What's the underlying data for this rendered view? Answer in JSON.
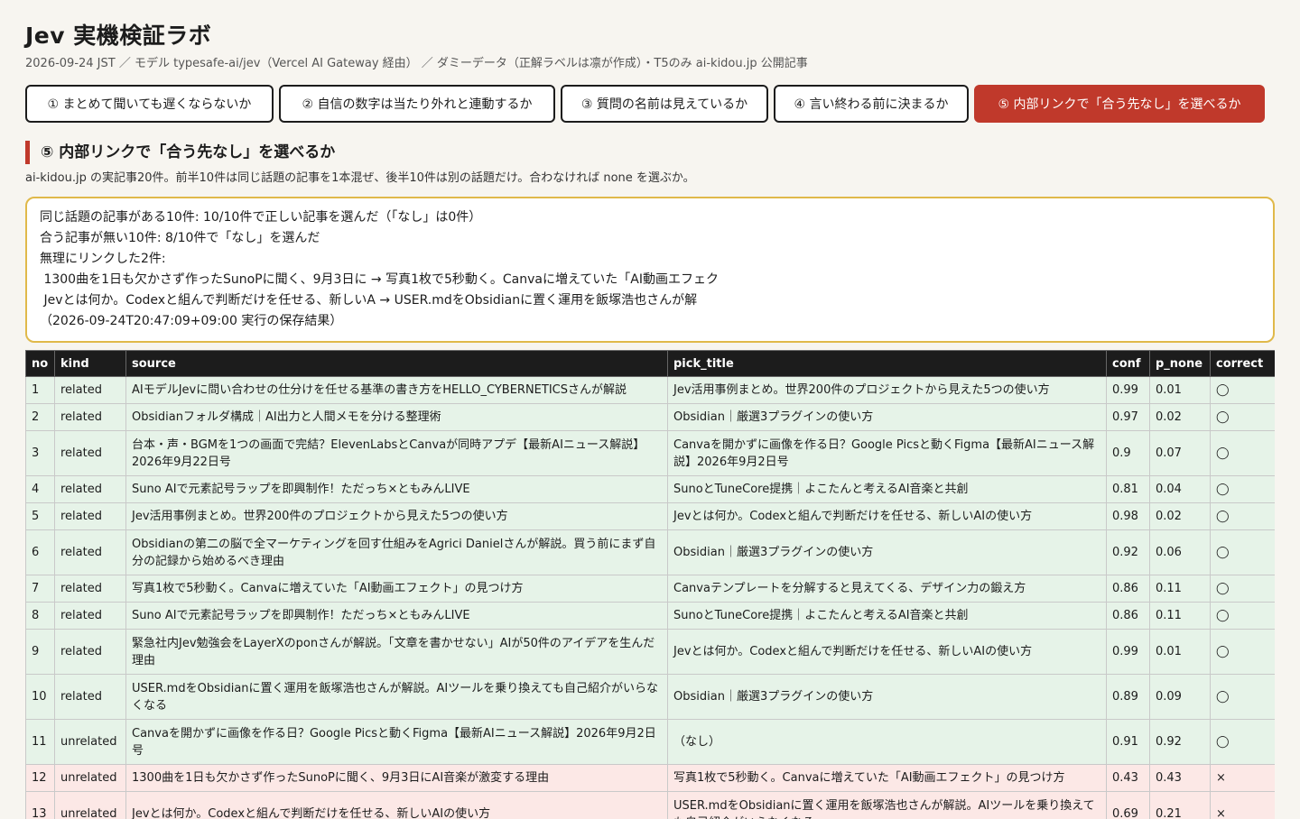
{
  "header": {
    "title": "Jev 実機検証ラボ",
    "subtitle": "2026-09-24 JST ／ モデル typesafe-ai/jev（Vercel AI Gateway 経由） ／ ダミーデータ（正解ラベルは凛が作成）・T5のみ ai-kidou.jp 公開記事"
  },
  "tabs": [
    {
      "label": "① まとめて聞いても遅くならないか"
    },
    {
      "label": "② 自信の数字は当たり外れと連動するか"
    },
    {
      "label": "③ 質問の名前は見えているか"
    },
    {
      "label": "④ 言い終わる前に決まるか"
    },
    {
      "label": "⑤ 内部リンクで「合う先なし」を選べるか"
    }
  ],
  "section": {
    "title": "⑤ 内部リンクで「合う先なし」を選べるか",
    "description": "ai-kidou.jp の実記事20件。前半10件は同じ話題の記事を1本混ぜ、後半10件は別の話題だけ。合わなければ none を選ぶか。"
  },
  "summary": {
    "lines": [
      "同じ話題の記事がある10件: 10/10件で正しい記事を選んだ（「なし」は0件）",
      "合う記事が無い10件: 8/10件で「なし」を選んだ",
      "無理にリンクした2件:",
      " 1300曲を1日も欠かさず作ったSunoPに聞く、9月3日に → 写真1枚で5秒動く。Canvaに増えていた「AI動画エフェク",
      " Jevとは何か。Codexと組んで判断だけを任せる、新しいA → USER.mdをObsidianに置く運用を飯塚浩也さんが解",
      "（2026-09-24T20:47:09+09:00 実行の保存結果）"
    ]
  },
  "table": {
    "headers": [
      "no",
      "kind",
      "source",
      "pick_title",
      "conf",
      "p_none",
      "correct"
    ],
    "rows": [
      {
        "no": "1",
        "kind": "related",
        "source": "AIモデルJevに問い合わせの仕分けを任せる基準の書き方をHELLO_CYBERNETICSさんが解説",
        "pick": "Jev活用事例まとめ。世界200件のプロジェクトから見えた5つの使い方",
        "conf": "0.99",
        "p_none": "0.01",
        "correct": "◯",
        "ok": true
      },
      {
        "no": "2",
        "kind": "related",
        "source": "Obsidianフォルダ構成｜AI出力と人間メモを分ける整理術",
        "pick": "Obsidian｜厳選3プラグインの使い方",
        "conf": "0.97",
        "p_none": "0.02",
        "correct": "◯",
        "ok": true
      },
      {
        "no": "3",
        "kind": "related",
        "source": "台本・声・BGMを1つの画面で完結？ElevenLabsとCanvaが同時アプデ【最新AIニュース解説】2026年9月22日号",
        "pick": "Canvaを開かずに画像を作る日？Google Picsと動くFigma【最新AIニュース解説】2026年9月2日号",
        "conf": "0.9",
        "p_none": "0.07",
        "correct": "◯",
        "ok": true
      },
      {
        "no": "4",
        "kind": "related",
        "source": "Suno AIで元素記号ラップを即興制作！ただっち×ともみんLIVE",
        "pick": "SunoとTuneCore提携｜よこたんと考えるAI音楽と共創",
        "conf": "0.81",
        "p_none": "0.04",
        "correct": "◯",
        "ok": true
      },
      {
        "no": "5",
        "kind": "related",
        "source": "Jev活用事例まとめ。世界200件のプロジェクトから見えた5つの使い方",
        "pick": "Jevとは何か。Codexと組んで判断だけを任せる、新しいAIの使い方",
        "conf": "0.98",
        "p_none": "0.02",
        "correct": "◯",
        "ok": true
      },
      {
        "no": "6",
        "kind": "related",
        "source": "Obsidianの第二の脳で全マーケティングを回す仕組みをAgrici Danielさんが解説。買う前にまず自分の記録から始めるべき理由",
        "pick": "Obsidian｜厳選3プラグインの使い方",
        "conf": "0.92",
        "p_none": "0.06",
        "correct": "◯",
        "ok": true
      },
      {
        "no": "7",
        "kind": "related",
        "source": "写真1枚で5秒動く。Canvaに増えていた「AI動画エフェクト」の見つけ方",
        "pick": "Canvaテンプレートを分解すると見えてくる、デザイン力の鍛え方",
        "conf": "0.86",
        "p_none": "0.11",
        "correct": "◯",
        "ok": true
      },
      {
        "no": "8",
        "kind": "related",
        "source": "Suno AIで元素記号ラップを即興制作！ただっち×ともみんLIVE",
        "pick": "SunoとTuneCore提携｜よこたんと考えるAI音楽と共創",
        "conf": "0.86",
        "p_none": "0.11",
        "correct": "◯",
        "ok": true
      },
      {
        "no": "9",
        "kind": "related",
        "source": "緊急社内Jev勉強会をLayerXのponさんが解説。「文章を書かせない」AIが50件のアイデアを生んだ理由",
        "pick": "Jevとは何か。Codexと組んで判断だけを任せる、新しいAIの使い方",
        "conf": "0.99",
        "p_none": "0.01",
        "correct": "◯",
        "ok": true
      },
      {
        "no": "10",
        "kind": "related",
        "source": "USER.mdをObsidianに置く運用を飯塚浩也さんが解説。AIツールを乗り換えても自己紹介がいらなくなる",
        "pick": "Obsidian｜厳選3プラグインの使い方",
        "conf": "0.89",
        "p_none": "0.09",
        "correct": "◯",
        "ok": true
      },
      {
        "no": "11",
        "kind": "unrelated",
        "source": "Canvaを開かずに画像を作る日？Google Picsと動くFigma【最新AIニュース解説】2026年9月2日号",
        "pick": "（なし）",
        "conf": "0.91",
        "p_none": "0.92",
        "correct": "◯",
        "ok": true
      },
      {
        "no": "12",
        "kind": "unrelated",
        "source": "1300曲を1日も欠かさず作ったSunoPに聞く、9月3日にAI音楽が激変する理由",
        "pick": "写真1枚で5秒動く。Canvaに増えていた「AI動画エフェクト」の見つけ方",
        "conf": "0.43",
        "p_none": "0.43",
        "correct": "×",
        "ok": false
      },
      {
        "no": "13",
        "kind": "unrelated",
        "source": "Jevとは何か。Codexと組んで判断だけを任せる、新しいAIの使い方",
        "pick": "USER.mdをObsidianに置く運用を飯塚浩也さんが解説。AIツールを乗り換えても自己紹介がいらなくなる",
        "conf": "0.69",
        "p_none": "0.21",
        "correct": "×",
        "ok": false
      }
    ]
  }
}
